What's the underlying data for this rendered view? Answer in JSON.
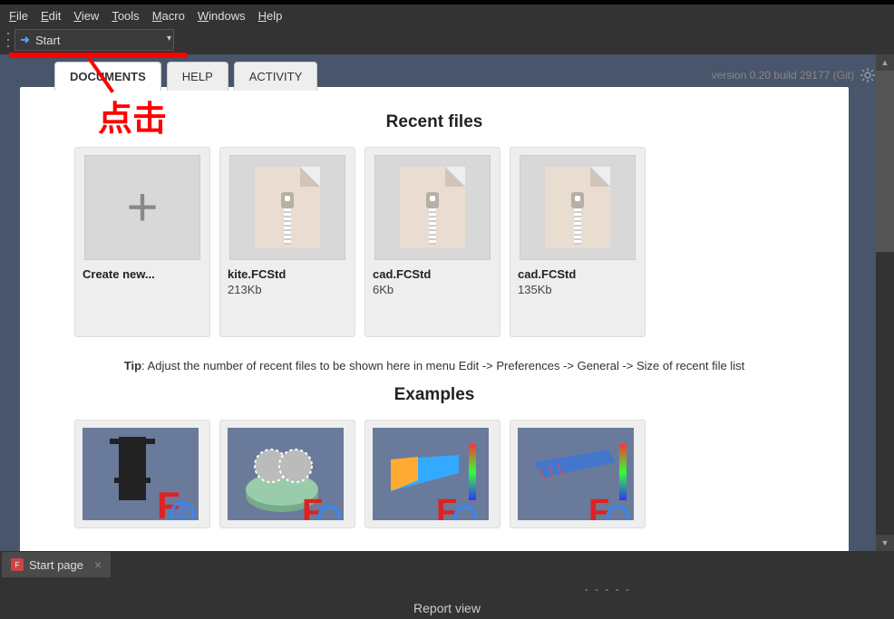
{
  "menu": {
    "file": "File",
    "edit": "Edit",
    "view": "View",
    "tools": "Tools",
    "macro": "Macro",
    "windows": "Windows",
    "help": "Help"
  },
  "workbench": {
    "current": "Start"
  },
  "annotation": {
    "text": "点击"
  },
  "tabs": {
    "documents": "DOCUMENTS",
    "help": "HELP",
    "activity": "ACTIVITY"
  },
  "version": "version 0.20 build 29177 (Git)",
  "sections": {
    "recent": "Recent files",
    "examples": "Examples"
  },
  "recent": [
    {
      "name": "Create new...",
      "size": "",
      "new": true
    },
    {
      "name": "kite.FCStd",
      "size": "213Kb"
    },
    {
      "name": "cad.FCStd",
      "size": "6Kb"
    },
    {
      "name": "cad.FCStd",
      "size": "135Kb"
    }
  ],
  "tip": {
    "label": "Tip",
    "text": ": Adjust the number of recent files to be shown here in menu Edit -> Preferences -> General -> Size of recent file list"
  },
  "dock": {
    "startpage": "Start page"
  },
  "bottom": {
    "dashes": "- - - - -",
    "report": "Report view"
  }
}
